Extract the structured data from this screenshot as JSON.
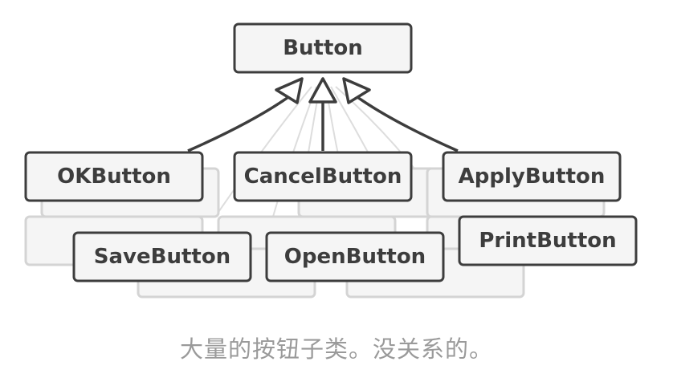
{
  "diagram": {
    "parent": {
      "label": "Button"
    },
    "children": [
      {
        "label": "OKButton"
      },
      {
        "label": "CancelButton"
      },
      {
        "label": "ApplyButton"
      },
      {
        "label": "SaveButton"
      },
      {
        "label": "OpenButton"
      },
      {
        "label": "PrintButton"
      }
    ],
    "caption": "大量的按钮子类。没关系的。",
    "colors": {
      "box_stroke": "#3d3d3d",
      "box_fill": "#f5f5f5",
      "ghost_stroke": "#d4d4d4",
      "caption": "#9a9a9a"
    }
  }
}
